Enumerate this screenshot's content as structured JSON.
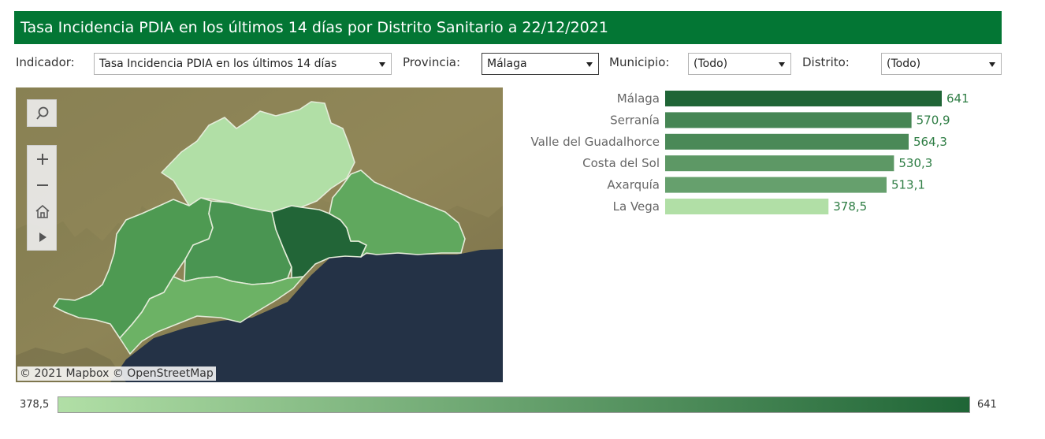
{
  "header": {
    "title": "Tasa Incidencia PDIA en los últimos 14 días por Distrito Sanitario a 22/12/2021"
  },
  "filters": {
    "indicador": {
      "label": "Indicador:",
      "value": "Tasa Incidencia PDIA en los últimos 14 días"
    },
    "provincia": {
      "label": "Provincia:",
      "value": "Málaga"
    },
    "municipio": {
      "label": "Municipio:",
      "value": "(Todo)"
    },
    "distrito": {
      "label": "Distrito:",
      "value": "(Todo)"
    }
  },
  "map": {
    "attribution": "© 2021 Mapbox  © OpenStreetMap",
    "tools": [
      "search-icon",
      "zoom-in-icon",
      "zoom-out-icon",
      "home-icon",
      "play-icon"
    ]
  },
  "colors": {
    "header": "#037634",
    "scale_low": "#b1dfa6",
    "scale_high": "#1f6536",
    "sea": "#243246",
    "land": "#8b8356"
  },
  "chart_data": {
    "type": "bar",
    "orientation": "horizontal",
    "categories": [
      "Málaga",
      "Serranía",
      "Valle del Guadalhorce",
      "Costa del Sol",
      "Axarquía",
      "La Vega"
    ],
    "values": [
      641,
      570.9,
      564.3,
      530.3,
      513.1,
      378.5
    ],
    "value_labels": [
      "641",
      "570,9",
      "564,3",
      "530,3",
      "513,1",
      "378,5"
    ],
    "xlim": [
      0,
      641
    ],
    "color_scale": {
      "min": 378.5,
      "max": 641,
      "min_label": "378,5",
      "max_label": "641"
    }
  }
}
